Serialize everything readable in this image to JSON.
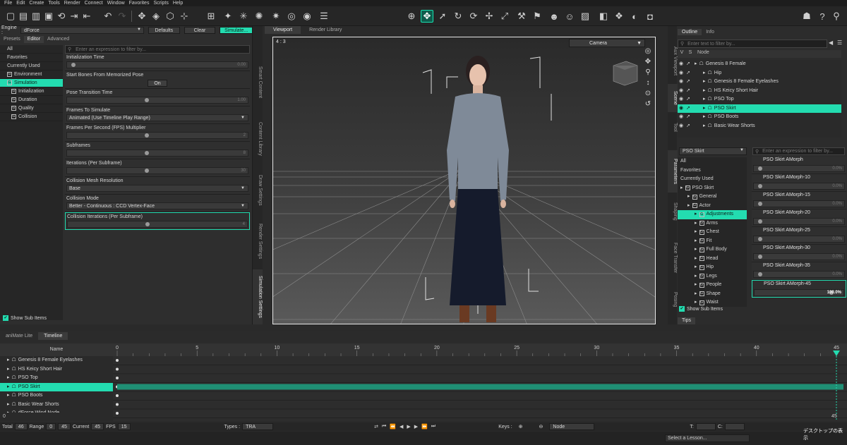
{
  "menu": [
    "File",
    "Edit",
    "Create",
    "Tools",
    "Render",
    "Connect",
    "Window",
    "Favorites",
    "Scripts",
    "Help"
  ],
  "left": {
    "engine_label": "Engine :",
    "engine_value": "dForce",
    "defaults": "Defaults",
    "clear": "Clear",
    "simulate": "Simulate...",
    "tabs": [
      "Presets",
      "Editor",
      "Advanced"
    ],
    "categories": [
      {
        "label": "All",
        "icon": false
      },
      {
        "label": "Favorites",
        "icon": false
      },
      {
        "label": "Currently Used",
        "icon": false
      },
      {
        "label": "Environment",
        "icon": true
      },
      {
        "label": "Simulation",
        "icon": true,
        "selected": true
      },
      {
        "label": "Initialization",
        "icon": true
      },
      {
        "label": "Duration",
        "icon": true
      },
      {
        "label": "Quality",
        "icon": true
      },
      {
        "label": "Collision",
        "icon": true
      }
    ],
    "filter_placeholder": "Enter an expression to filter by...",
    "props": [
      {
        "label": "Initialization Time",
        "kind": "slider",
        "value": "0.00",
        "knob": 0.0
      },
      {
        "label": "Start Bones From Memorized Pose",
        "kind": "toggle",
        "value": "On"
      },
      {
        "label": "Pose Transition Time",
        "kind": "slider",
        "value": "1.00",
        "knob": 0.45
      },
      {
        "label": "Frames To Simulate",
        "kind": "dropdown",
        "value": "Animated (Use Timeline Play Range)"
      },
      {
        "label": "Frames Per Second (FPS) Multiplier",
        "kind": "slider",
        "value": "2",
        "knob": 0.45
      },
      {
        "label": "Subframes",
        "kind": "slider",
        "value": "8",
        "knob": 0.45
      },
      {
        "label": "Iterations (Per Subframe)",
        "kind": "slider",
        "value": "30",
        "knob": 0.45
      },
      {
        "label": "Collision Mesh Resolution",
        "kind": "dropdown",
        "value": "Base"
      },
      {
        "label": "Collision Mode",
        "kind": "dropdown",
        "value": "Better - Continuous : CCD Vertex-Face"
      },
      {
        "label": "Collision Iterations (Per Subframe)",
        "kind": "slider",
        "value": "4",
        "knob": 0.45,
        "highlight": true
      }
    ],
    "show_sub_items": "Show Sub Items",
    "vtabs": [
      "Smart Content",
      "Content Library",
      "Draw Settings",
      "Render Settings",
      "Simulation Settings"
    ]
  },
  "viewport": {
    "tabs": [
      "Viewport",
      "Render Library"
    ],
    "ratio": "4 : 3",
    "camera": "Camera"
  },
  "right": {
    "vtabs_top": [
      "Aux Viewport",
      "Scene",
      "Tool"
    ],
    "vtabs_bottom": [
      "Parameters",
      "Shaping",
      "Face Transfer",
      "Posing"
    ],
    "tabs": [
      "Outline",
      "Info"
    ],
    "filter_placeholder": "Enter text to filter by...",
    "cols": [
      "V",
      "S",
      "Node"
    ],
    "scene": [
      {
        "label": "Genesis 8 Female",
        "indent": 0
      },
      {
        "label": "Hip",
        "indent": 1
      },
      {
        "label": "Genesis 8 Female Eyelashes",
        "indent": 1
      },
      {
        "label": "HS Keicy Short Hair",
        "indent": 1
      },
      {
        "label": "PSO Top",
        "indent": 1
      },
      {
        "label": "PSO Skirt",
        "indent": 1,
        "selected": true
      },
      {
        "label": "PSO Boots",
        "indent": 1
      },
      {
        "label": "Basic Wear Shorts",
        "indent": 1
      }
    ],
    "param_node": "PSO Skirt",
    "param_filter": "Enter an expression to filter by...",
    "plist": [
      {
        "label": "All",
        "indent": 0
      },
      {
        "label": "Favorites",
        "indent": 0
      },
      {
        "label": "Currently Used",
        "indent": 0
      },
      {
        "label": "PSO Skirt",
        "indent": 0
      },
      {
        "label": "General",
        "indent": 1
      },
      {
        "label": "Actor",
        "indent": 1
      },
      {
        "label": "Adjustments",
        "indent": 2,
        "selected": true
      },
      {
        "label": "Arms",
        "indent": 2
      },
      {
        "label": "Chest",
        "indent": 2
      },
      {
        "label": "Fit",
        "indent": 2
      },
      {
        "label": "Full Body",
        "indent": 2
      },
      {
        "label": "Head",
        "indent": 2
      },
      {
        "label": "Hip",
        "indent": 2
      },
      {
        "label": "Legs",
        "indent": 2
      },
      {
        "label": "People",
        "indent": 2
      },
      {
        "label": "Shape",
        "indent": 2
      },
      {
        "label": "Waist",
        "indent": 2
      }
    ],
    "morphs": [
      {
        "label": "PSO Skirt AMorph",
        "value": "0.0%",
        "knob": 0.0
      },
      {
        "label": "PSO Skirt AMorph-10",
        "value": "0.0%",
        "knob": 0.0
      },
      {
        "label": "PSO Skirt AMorph-15",
        "value": "0.0%",
        "knob": 0.0
      },
      {
        "label": "PSO Skirt AMorph-20",
        "value": "0.0%",
        "knob": 0.0
      },
      {
        "label": "PSO Skirt AMorph-25",
        "value": "0.0%",
        "knob": 0.0
      },
      {
        "label": "PSO Skirt AMorph-30",
        "value": "0.0%",
        "knob": 0.0
      },
      {
        "label": "PSO Skirt AMorph-35",
        "value": "0.0%",
        "knob": 0.0
      },
      {
        "label": "PSO Skirt AMorph-45",
        "value": "100.0%",
        "knob": 1.0,
        "highlight": true
      }
    ],
    "show_sub_items": "Show Sub Items",
    "tips": "Tips"
  },
  "timeline": {
    "tabs": [
      "aniMate Lite",
      "Timeline"
    ],
    "name_header": "Name",
    "ticks": [
      "0",
      "5",
      "10",
      "15",
      "20",
      "25",
      "30",
      "35",
      "40",
      "45"
    ],
    "rows": [
      {
        "label": "Genesis 8 Female Eyelashes"
      },
      {
        "label": "HS Keicy Short Hair"
      },
      {
        "label": "PSO Top"
      },
      {
        "label": "PSO Skirt",
        "selected": true
      },
      {
        "label": "PSO Boots"
      },
      {
        "label": "Basic Wear Shorts"
      },
      {
        "label": "dForce Wind Node"
      }
    ],
    "scroll_start": "0",
    "scroll_end": "45",
    "total_label": "Total",
    "total": "46",
    "range_label": "Range",
    "range_start": "0",
    "range_end": "45",
    "current_label": "Current",
    "current": "45",
    "fps_label": "FPS",
    "fps": "15",
    "types_label": "Types :",
    "types": "TRA",
    "keys_label": "Keys :",
    "node": "Node",
    "t_label": "T:",
    "c_label": "C:"
  },
  "status": {
    "lesson": "Select a Lesson...",
    "jp": "デスクトップの表示"
  },
  "colors": {
    "accent": "#23dcb0"
  }
}
